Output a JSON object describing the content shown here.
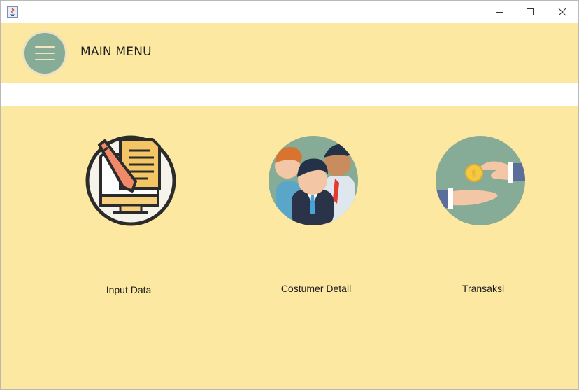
{
  "window": {
    "controls": {
      "minimize_icon": "minimize-icon",
      "maximize_icon": "maximize-icon",
      "close_icon": "close-icon"
    }
  },
  "header": {
    "title": "MAIN MENU",
    "menu_icon": "hamburger-menu-icon"
  },
  "menu_items": [
    {
      "label": "Input Data",
      "icon": "document-pencil-icon"
    },
    {
      "label": "Costumer Detail",
      "icon": "customers-group-icon"
    },
    {
      "label": "Transaksi",
      "icon": "coin-hand-icon"
    }
  ],
  "colors": {
    "background": "#fde8a1",
    "accent_green": "#86ab97",
    "titlebar": "#ffffff"
  }
}
